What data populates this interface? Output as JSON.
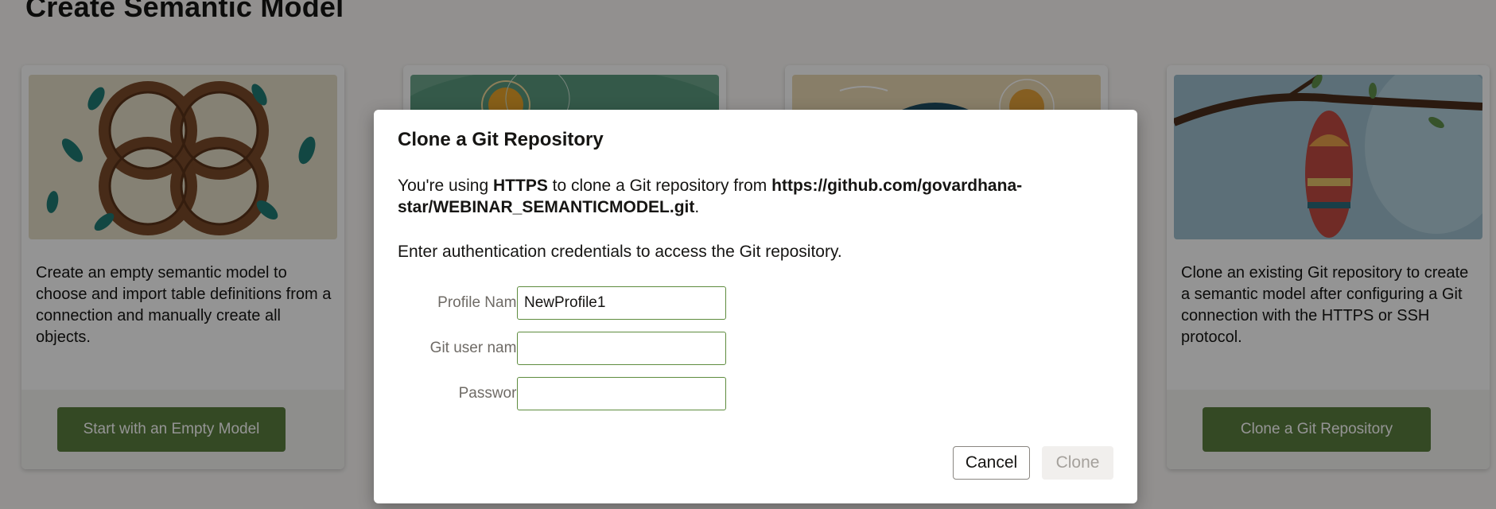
{
  "page": {
    "title": "Create Semantic Model"
  },
  "cards": [
    {
      "description": "Create an empty semantic model to choose and import table definitions from a connection and manually create all objects.",
      "button_label": "Start with an Empty Model",
      "image_icon": "interlocking-rings-illustration"
    },
    {
      "description": "",
      "button_label": "",
      "image_icon": "sun-landscape-illustration"
    },
    {
      "description": "",
      "button_label": "",
      "image_icon": "mountain-sun-illustration"
    },
    {
      "description": "Clone an existing Git repository to create a semantic model after configuring a Git connection with the HTTPS or SSH protocol.",
      "button_label": "Clone a Git Repository",
      "image_icon": "branch-cocoon-illustration"
    }
  ],
  "dialog": {
    "title": "Clone a Git Repository",
    "info_prefix": "You're using ",
    "info_protocol": "HTTPS",
    "info_middle": " to clone a Git repository from ",
    "info_url_line1": "https://github.com/govardhana-",
    "info_url_line2": "star/WEBINAR_SEMANTICMODEL.git",
    "info_suffix": ".",
    "instructions": "Enter authentication credentials to access the Git repository.",
    "fields": {
      "profile_name": {
        "label": "Profile Name",
        "value": "NewProfile1"
      },
      "git_user_name": {
        "label": "Git user name",
        "value": ""
      },
      "password": {
        "label": "Password",
        "value": ""
      }
    },
    "cancel_label": "Cancel",
    "clone_label": "Clone"
  },
  "colors": {
    "accent_green": "#5a7e3e",
    "input_border": "#5e8c3e",
    "overlay": "rgba(0,0,0,0.42)"
  }
}
